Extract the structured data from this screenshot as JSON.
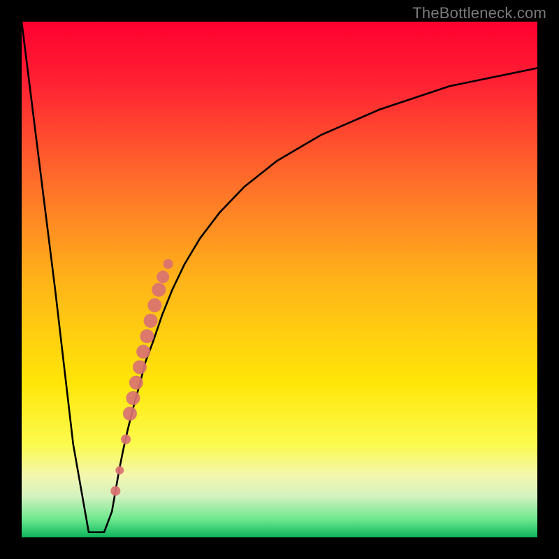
{
  "watermark": {
    "text": "TheBottleneck.com"
  },
  "colors": {
    "black": "#000000",
    "curve": "#000000",
    "dot_fill": "#d97272",
    "dot_stroke": "#c75b5b",
    "gradient_stops": [
      {
        "offset": 0.0,
        "color": "#ff0030"
      },
      {
        "offset": 0.12,
        "color": "#ff2233"
      },
      {
        "offset": 0.3,
        "color": "#ff6a2b"
      },
      {
        "offset": 0.5,
        "color": "#ffb319"
      },
      {
        "offset": 0.7,
        "color": "#ffe608"
      },
      {
        "offset": 0.82,
        "color": "#fbfb4e"
      },
      {
        "offset": 0.88,
        "color": "#f3f6ae"
      },
      {
        "offset": 0.92,
        "color": "#d4f2bf"
      },
      {
        "offset": 0.965,
        "color": "#6de88e"
      },
      {
        "offset": 1.0,
        "color": "#0db55c"
      }
    ]
  },
  "chart_data": {
    "type": "line",
    "title": "",
    "xlabel": "",
    "ylabel": "",
    "x": [
      0,
      6.5,
      10,
      13,
      16,
      17.5,
      18.2,
      18.9,
      19.7,
      20.6,
      21.6,
      22.7,
      24.0,
      25.5,
      27.2,
      29.2,
      31.6,
      34.6,
      38.4,
      43.2,
      49.5,
      58.0,
      69.5,
      83.0,
      100
    ],
    "values": [
      100,
      48,
      18,
      1,
      1,
      5,
      9,
      13,
      17,
      21,
      25,
      29,
      34,
      38,
      43,
      48,
      53,
      58,
      63,
      68,
      73,
      78,
      83,
      87.5,
      91
    ],
    "xlim": [
      0,
      100
    ],
    "ylim": [
      0,
      100
    ],
    "annotations": {
      "dots": [
        {
          "x": 18.2,
          "y_bottleneck": 9,
          "r": 7
        },
        {
          "x": 19.0,
          "y_bottleneck": 13,
          "r": 6
        },
        {
          "x": 20.2,
          "y_bottleneck": 19,
          "r": 7
        },
        {
          "x": 21.0,
          "y_bottleneck": 24,
          "r": 10
        },
        {
          "x": 21.6,
          "y_bottleneck": 27,
          "r": 10
        },
        {
          "x": 22.2,
          "y_bottleneck": 30,
          "r": 10
        },
        {
          "x": 22.9,
          "y_bottleneck": 33,
          "r": 10
        },
        {
          "x": 23.6,
          "y_bottleneck": 36,
          "r": 10
        },
        {
          "x": 24.3,
          "y_bottleneck": 39,
          "r": 10
        },
        {
          "x": 25.0,
          "y_bottleneck": 42,
          "r": 10
        },
        {
          "x": 25.8,
          "y_bottleneck": 45,
          "r": 10
        },
        {
          "x": 26.6,
          "y_bottleneck": 48,
          "r": 10
        },
        {
          "x": 27.4,
          "y_bottleneck": 50.5,
          "r": 9
        },
        {
          "x": 28.4,
          "y_bottleneck": 53,
          "r": 7
        }
      ]
    }
  }
}
